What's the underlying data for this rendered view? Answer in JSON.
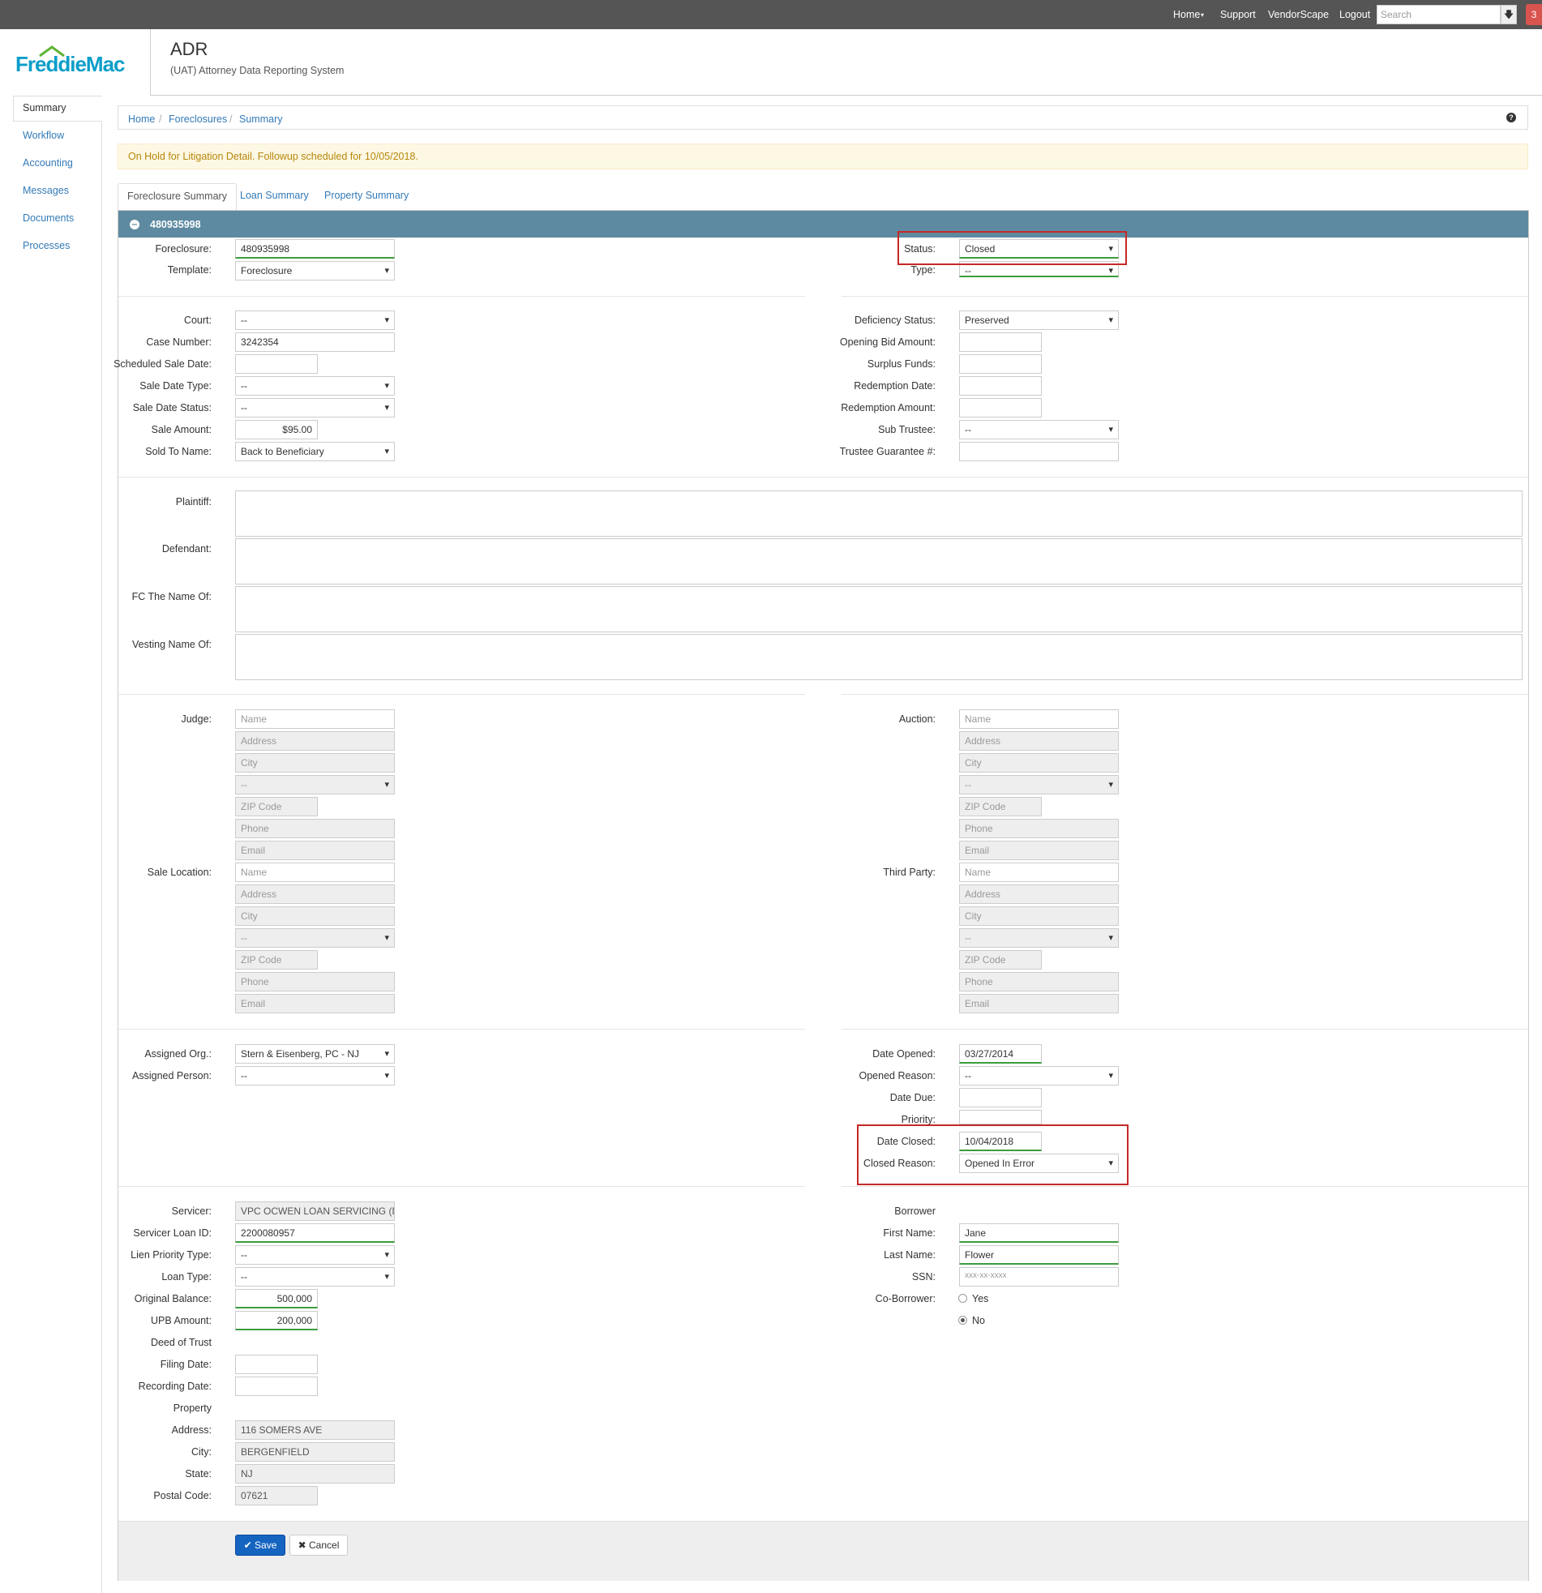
{
  "topnav": {
    "home": "Home",
    "support": "Support",
    "vendorscape": "VendorScape",
    "logout": "Logout",
    "search_placeholder": "Search",
    "badge": "3"
  },
  "header": {
    "logo_text": "FreddieMac",
    "title": "ADR",
    "subtitle": "(UAT) Attorney Data Reporting System"
  },
  "sidebar": {
    "items": [
      "Summary",
      "Workflow",
      "Accounting",
      "Messages",
      "Documents",
      "Processes"
    ]
  },
  "breadcrumb": [
    "Home",
    "Foreclosures",
    "Summary"
  ],
  "alert": "On Hold for Litigation Detail. Followup scheduled for 10/05/2018.",
  "tabs": [
    "Foreclosure Summary",
    "Loan Summary",
    "Property Summary"
  ],
  "panel": {
    "title": "480935998"
  },
  "section1": {
    "foreclosure_label": "Foreclosure:",
    "foreclosure_value": "480935998",
    "template_label": "Template:",
    "template_value": "Foreclosure",
    "status_label": "Status:",
    "status_value": "Closed",
    "type_label": "Type:",
    "type_value": "--"
  },
  "section2": {
    "court_label": "Court:",
    "court_value": "--",
    "case_label": "Case Number:",
    "case_value": "3242354",
    "sched_label": "Scheduled Sale Date:",
    "sched_value": "",
    "saletype_label": "Sale Date Type:",
    "saletype_value": "--",
    "salestatus_label": "Sale Date Status:",
    "salestatus_value": "--",
    "saleamt_label": "Sale Amount:",
    "saleamt_value": "$95.00",
    "soldto_label": "Sold To Name:",
    "soldto_value": "Back to Beneficiary",
    "deficiency_label": "Deficiency Status:",
    "deficiency_value": "Preserved",
    "openbid_label": "Opening Bid Amount:",
    "surplus_label": "Surplus Funds:",
    "redemdate_label": "Redemption Date:",
    "redemamt_label": "Redemption Amount:",
    "subtrustee_label": "Sub Trustee:",
    "subtrustee_value": "--",
    "trusteeg_label": "Trustee Guarantee #:"
  },
  "section3": {
    "plaintiff": "Plaintiff:",
    "defendant": "Defendant:",
    "fcname": "FC The Name Of:",
    "vesting": "Vesting Name Of:"
  },
  "contacts": {
    "judge": "Judge:",
    "sale_location": "Sale Location:",
    "auction": "Auction:",
    "third_party": "Third Party:",
    "ph_name": "Name",
    "ph_address": "Address",
    "ph_city": "City",
    "ph_state": "--",
    "ph_zip": "ZIP Code",
    "ph_phone": "Phone",
    "ph_email": "Email"
  },
  "section5": {
    "org_label": "Assigned Org.:",
    "org_value": "Stern & Eisenberg, PC - NJ",
    "person_label": "Assigned Person:",
    "person_value": "--",
    "dateopened_label": "Date Opened:",
    "dateopened_value": "03/27/2014",
    "openreason_label": "Opened Reason:",
    "openreason_value": "--",
    "datedue_label": "Date Due:",
    "priority_label": "Priority:",
    "dateclosed_label": "Date Closed:",
    "dateclosed_value": "10/04/2018",
    "closedreason_label": "Closed Reason:",
    "closedreason_value": "Opened In Error"
  },
  "section6": {
    "servicer_label": "Servicer:",
    "servicer_value": "VPC OCWEN LOAN SERVICING (D",
    "loanid_label": "Servicer Loan ID:",
    "loanid_value": "2200080957",
    "lien_label": "Lien Priority Type:",
    "lien_value": "--",
    "loantype_label": "Loan Type:",
    "loantype_value": "--",
    "origbal_label": "Original Balance:",
    "origbal_value": "500,000",
    "upb_label": "UPB Amount:",
    "upb_value": "200,000",
    "deed_label": "Deed of Trust",
    "filing_label": "Filing Date:",
    "recording_label": "Recording Date:",
    "property_label": "Property",
    "address_label": "Address:",
    "address_value": "116 SOMERS AVE",
    "city_label": "City:",
    "city_value": "BERGENFIELD",
    "state_label": "State:",
    "state_value": "NJ",
    "postal_label": "Postal Code:",
    "postal_value": "07621",
    "borrower_label": "Borrower",
    "first_label": "First Name:",
    "first_value": "Jane",
    "last_label": "Last Name:",
    "last_value": "Flower",
    "ssn_label": "SSN:",
    "ssn_placeholder": "xxx-xx-xxxx",
    "coborrower_label": "Co-Borrower:",
    "yes": "Yes",
    "no": "No"
  },
  "buttons": {
    "save": "Save",
    "cancel": "Cancel"
  },
  "colors": {
    "panel_header": "#5d8aa0",
    "highlight": "#c62828",
    "primary": "#1565c0",
    "alert_bg": "#fcf8e3"
  }
}
